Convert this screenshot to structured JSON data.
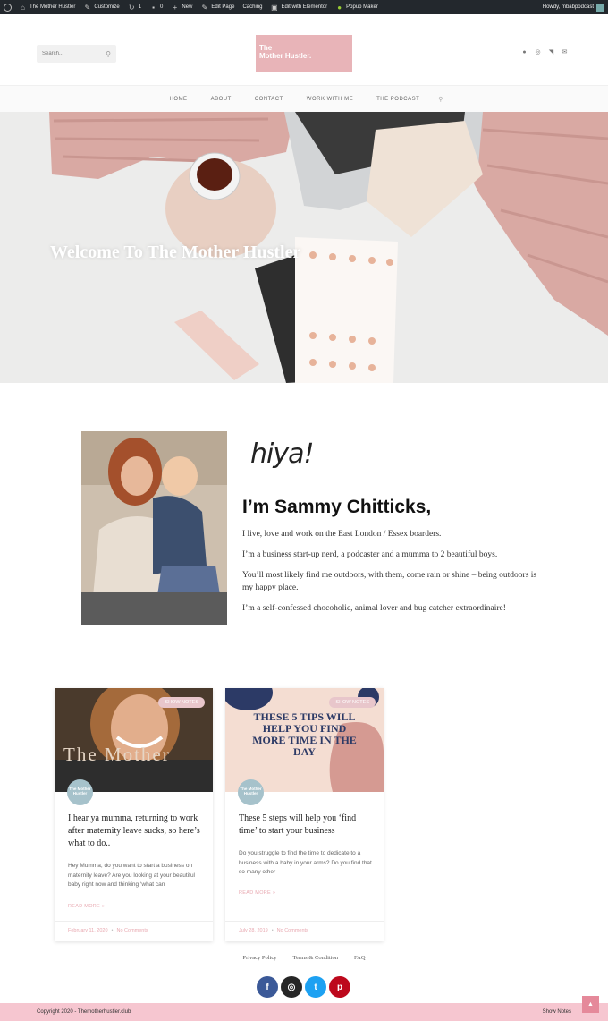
{
  "adminbar": {
    "items": [
      {
        "icon": "home-icon",
        "label": "The Mother Hustler"
      },
      {
        "icon": "brush-icon",
        "label": "Customize"
      },
      {
        "icon": "refresh-icon",
        "label": "1"
      },
      {
        "icon": "comment-icon",
        "label": "0"
      },
      {
        "icon": "plus-icon",
        "label": "New"
      },
      {
        "icon": "pencil-icon",
        "label": "Edit Page"
      },
      {
        "icon": "",
        "label": "Caching"
      },
      {
        "icon": "elementor-icon",
        "label": "Edit with Elementor"
      },
      {
        "icon": "popup-icon",
        "label": "Popup Maker"
      }
    ],
    "greeting": "Howdy, mbabpodcast"
  },
  "header": {
    "search_placeholder": "Search...",
    "logo_line1": "The",
    "logo_line2": "Mother Hustler."
  },
  "nav": {
    "items": [
      "HOME",
      "ABOUT",
      "CONTACT",
      "WORK WITH ME",
      "THE PODCAST"
    ]
  },
  "hero": {
    "title": "Welcome To The Mother Hustler"
  },
  "about": {
    "greeting": "hiya!",
    "name": "I’m Sammy Chitticks,",
    "paragraphs": [
      "I live, love and work on the East London / Essex boarders.",
      "I’m a business start-up nerd, a podcaster and a mumma to 2 beautiful boys.",
      "You’ll most likely find me outdoors, with them, come rain or shine – being outdoors is my happy place.",
      "I’m a self-confessed chocoholic, animal lover and bug catcher extraordinaire!"
    ]
  },
  "cards": [
    {
      "badge": "SHOW NOTES",
      "thumb_text": "The Mother",
      "avatar_text": "The Mother Hustler",
      "title": "I hear ya mumma, returning to work after maternity leave sucks, so here’s what to do..",
      "excerpt": "Hey Mumma, do you want to start a business on maternity leave? Are you looking at your beautiful baby right now and thinking ‘what can",
      "more": "READ MORE »",
      "date": "February 11, 2020",
      "comments": "No Comments"
    },
    {
      "badge": "SHOW NOTES",
      "thumb_text": "THESE 5 TIPS WILL HELP YOU FIND MORE TIME IN THE DAY",
      "avatar_text": "The Mother Hustler",
      "title": "These 5 steps will help you ‘find time’ to start your business",
      "excerpt": "Do you struggle to find the time to dedicate to a business with a baby in your arms? Do you find that so many other",
      "more": "READ MORE »",
      "date": "July 28, 2019",
      "comments": "No Comments"
    }
  ],
  "footer": {
    "links": [
      "Privacy Policy",
      "Terms & Condition",
      "FAQ"
    ],
    "social": [
      {
        "name": "facebook-icon",
        "glyph": "f",
        "color": "#3b5998"
      },
      {
        "name": "instagram-icon",
        "glyph": "◎",
        "color": "#262626"
      },
      {
        "name": "twitter-icon",
        "glyph": "t",
        "color": "#1da1f2"
      },
      {
        "name": "pinterest-icon",
        "glyph": "p",
        "color": "#bd081c"
      }
    ],
    "copyright": "Copyright 2020 - Themotherhustler.club",
    "show_notes": "Show Notes"
  },
  "colors": {
    "brand_pink": "#e8b4b8",
    "footer_bar": "#f6c6d0",
    "admin_bar": "#23282d"
  }
}
